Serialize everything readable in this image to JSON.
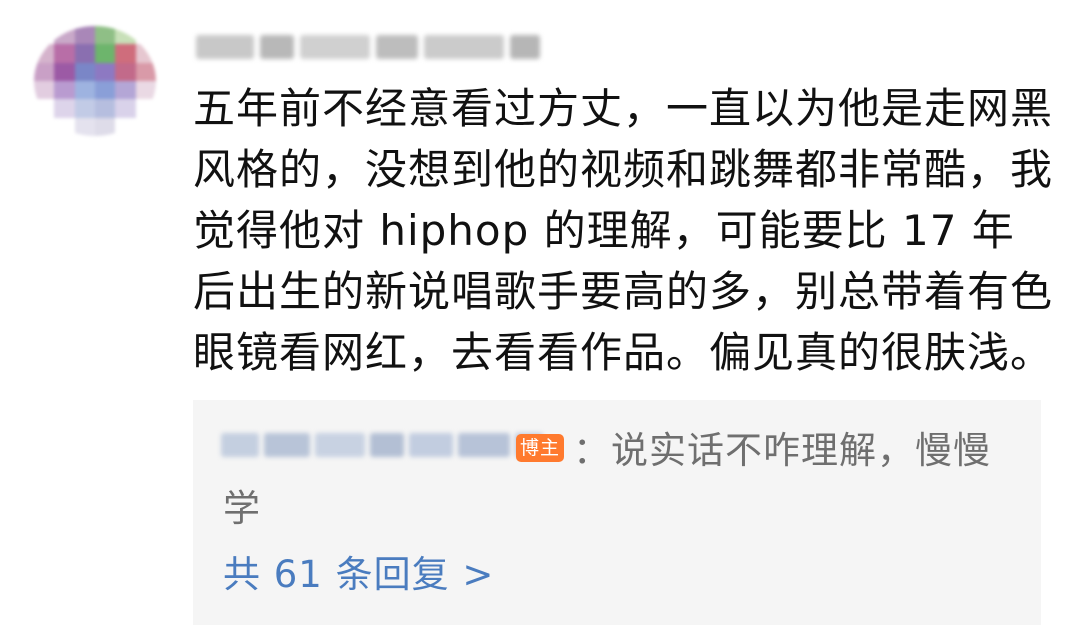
{
  "comment": {
    "text": "五年前不经意看过方丈，一直以为他是走网黑风格的，没想到他的视频和跳舞都非常酷，我觉得他对 hiphop 的理解，可能要比 17 年后出生的新说唱歌手要高的多，别总带着有色眼镜看网红，去看看作品。偏见真的很肤浅。"
  },
  "reply": {
    "badge": "博主",
    "text": "：说实话不咋理解，慢慢学",
    "count_link": "共 61 条回复 >"
  },
  "colors": {
    "text": "#111111",
    "reply_text": "#6f6f6f",
    "link": "#4a7cbf",
    "badge_bg": "#ff7a2e",
    "reply_bg": "#f5f5f5"
  }
}
